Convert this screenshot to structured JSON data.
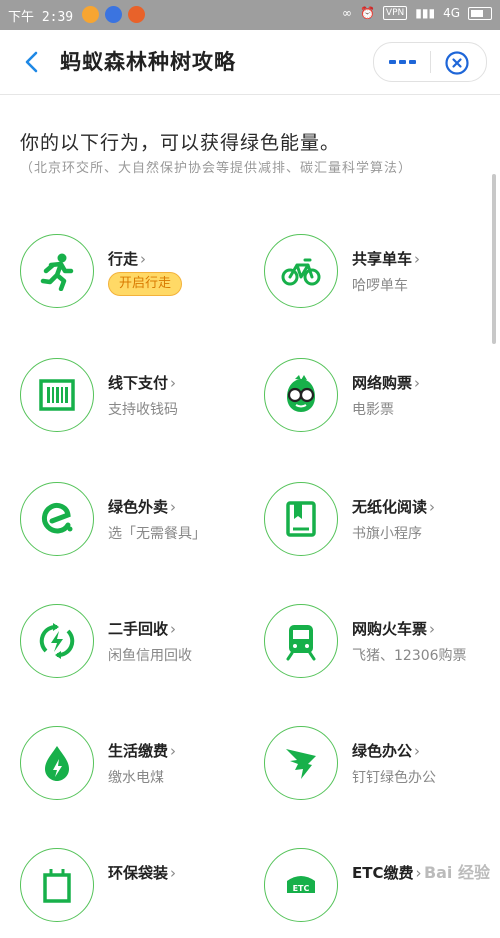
{
  "status_bar": {
    "time": "下午 2:39",
    "network": "4G",
    "vpn": "VPN"
  },
  "header": {
    "title": "蚂蚁森林种树攻略",
    "more_icon": "ellipsis-icon",
    "close_icon": "close-circle-icon"
  },
  "intro": {
    "title": "你的以下行为，可以获得绿色能量。",
    "note": "（北京环交所、大自然保护协会等提供减排、碳汇量科学算法）"
  },
  "items": [
    {
      "label": "行走",
      "sub": "",
      "pill": "开启行走",
      "icon": "running-icon"
    },
    {
      "label": "共享单车",
      "sub": "哈啰单车",
      "pill": "",
      "icon": "bicycle-icon"
    },
    {
      "label": "线下支付",
      "sub": "支持收钱码",
      "pill": "",
      "icon": "barcode-icon"
    },
    {
      "label": "网络购票",
      "sub": "电影票",
      "pill": "",
      "icon": "glasses-mascot-icon"
    },
    {
      "label": "绿色外卖",
      "sub": "选「无需餐具」",
      "pill": "",
      "icon": "eleme-icon"
    },
    {
      "label": "无纸化阅读",
      "sub": "书旗小程序",
      "pill": "",
      "icon": "book-icon"
    },
    {
      "label": "二手回收",
      "sub": "闲鱼信用回收",
      "pill": "",
      "icon": "recycle-bolt-icon"
    },
    {
      "label": "网购火车票",
      "sub": "飞猪、12306购票",
      "pill": "",
      "icon": "train-icon"
    },
    {
      "label": "生活缴费",
      "sub": "缴水电煤",
      "pill": "",
      "icon": "drop-bolt-icon"
    },
    {
      "label": "绿色办公",
      "sub": "钉钉绿色办公",
      "pill": "",
      "icon": "dingtalk-icon"
    },
    {
      "label": "环保袋装",
      "sub": "",
      "pill": "",
      "icon": "bag-icon"
    },
    {
      "label": "ETC缴费",
      "sub": "",
      "pill": "",
      "icon": "etc-icon"
    }
  ],
  "watermark": "Bai 经验"
}
